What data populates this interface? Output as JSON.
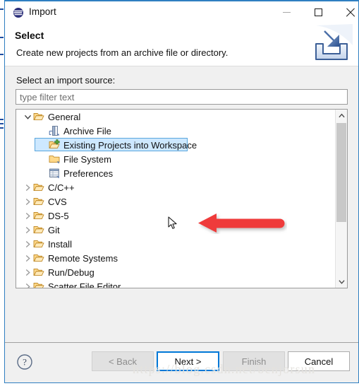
{
  "window": {
    "title": "Import",
    "icon": "eclipse-icon",
    "controls": {
      "minimize": "minimize-icon",
      "maximize": "maximize-icon",
      "close": "close-icon"
    }
  },
  "header": {
    "title": "Select",
    "description": "Create new projects from an archive file or directory.",
    "banner_icon": "import-wizard-icon"
  },
  "form": {
    "source_label": "Select an import source:",
    "filter_placeholder": "type filter text",
    "filter_value": ""
  },
  "tree": {
    "items": [
      {
        "label": "General",
        "level": 0,
        "twisty": "chevron-down-icon",
        "icon": "folder-open-icon",
        "selected": false
      },
      {
        "label": "Archive File",
        "level": 1,
        "twisty": "",
        "icon": "archive-file-icon",
        "selected": false
      },
      {
        "label": "Existing Projects into Workspace",
        "level": 1,
        "twisty": "",
        "icon": "folder-import-icon",
        "selected": true
      },
      {
        "label": "File System",
        "level": 1,
        "twisty": "",
        "icon": "folder-closed-icon",
        "selected": false
      },
      {
        "label": "Preferences",
        "level": 1,
        "twisty": "",
        "icon": "preferences-icon",
        "selected": false
      },
      {
        "label": "C/C++",
        "level": 0,
        "twisty": "chevron-right-icon",
        "icon": "folder-open-icon",
        "selected": false
      },
      {
        "label": "CVS",
        "level": 0,
        "twisty": "chevron-right-icon",
        "icon": "folder-open-icon",
        "selected": false
      },
      {
        "label": "DS-5",
        "level": 0,
        "twisty": "chevron-right-icon",
        "icon": "folder-open-icon",
        "selected": false
      },
      {
        "label": "Git",
        "level": 0,
        "twisty": "chevron-right-icon",
        "icon": "folder-open-icon",
        "selected": false
      },
      {
        "label": "Install",
        "level": 0,
        "twisty": "chevron-right-icon",
        "icon": "folder-open-icon",
        "selected": false
      },
      {
        "label": "Remote Systems",
        "level": 0,
        "twisty": "chevron-right-icon",
        "icon": "folder-open-icon",
        "selected": false
      },
      {
        "label": "Run/Debug",
        "level": 0,
        "twisty": "chevron-right-icon",
        "icon": "folder-open-icon",
        "selected": false
      },
      {
        "label": "Scatter File Editor",
        "level": 0,
        "twisty": "chevron-right-icon",
        "icon": "folder-open-icon",
        "selected": false
      }
    ],
    "scrollbar": {
      "up_arrow": "chevron-up-icon",
      "down_arrow": "chevron-down-icon"
    }
  },
  "annotation": {
    "arrow": "red-pointer-arrow",
    "color": "#ef3b3b"
  },
  "cursor": {
    "icon": "mouse-pointer-icon"
  },
  "footer": {
    "help": "help-icon",
    "buttons": [
      {
        "label": "< Back",
        "state": "disabled"
      },
      {
        "label": "Next >",
        "state": "default"
      },
      {
        "label": "Finish",
        "state": "disabled"
      },
      {
        "label": "Cancel",
        "state": "enabled"
      }
    ]
  },
  "watermark": {
    "text": "https://blog.csdn.net/benjorsun"
  },
  "colors": {
    "accent": "#0078d7",
    "window_border": "#2f7fc1",
    "selection_fill": "#cde8ff",
    "selection_border": "#5aa6dd",
    "dialog_bg": "#f0f0f0"
  }
}
